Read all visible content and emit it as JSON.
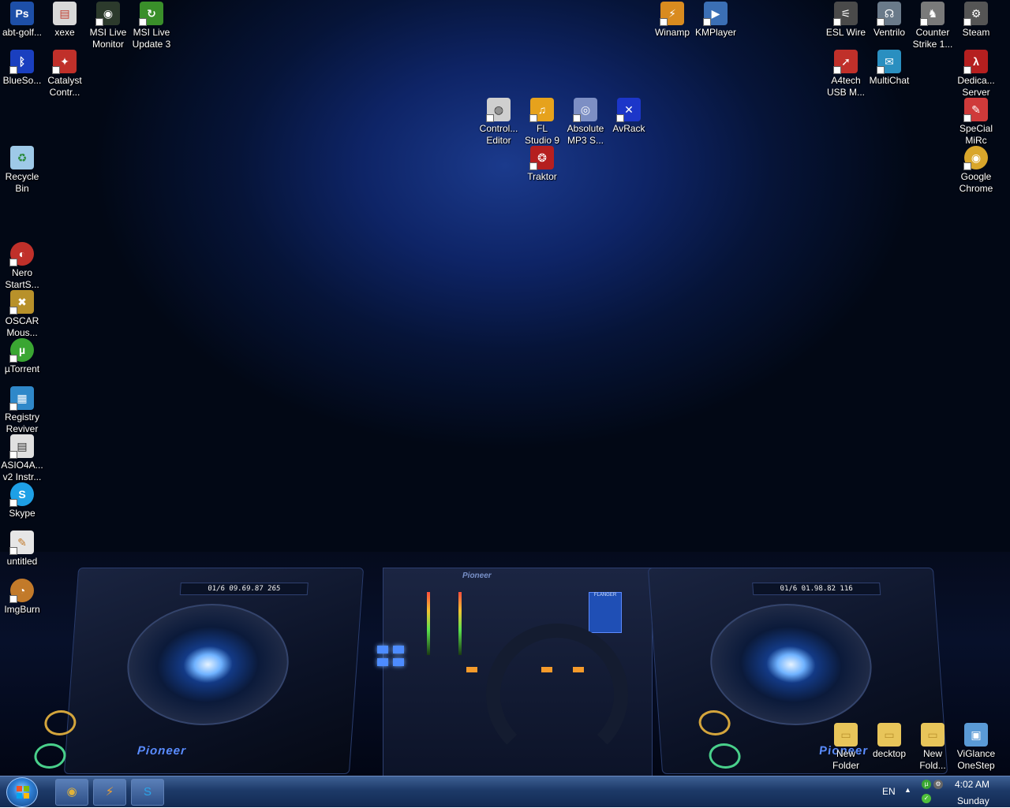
{
  "desktop": {
    "icons": [
      {
        "label": "abt-golf...",
        "icon": "photoshop-file-icon",
        "color": "#1d4fa8",
        "glyph": "Ps"
      },
      {
        "label": "xexe",
        "icon": "document-file-icon",
        "color": "#d9d9d9",
        "glyph": "▤"
      },
      {
        "label": "MSI Live\nMonitor",
        "icon": "msi-live-monitor-icon",
        "color": "#2c3a2c",
        "glyph": "◉"
      },
      {
        "label": "MSI Live\nUpdate 3",
        "icon": "msi-live-update-icon",
        "color": "#3a8f2a",
        "glyph": "↻"
      },
      {
        "label": "Winamp",
        "icon": "winamp-icon",
        "color": "#d98b1f",
        "glyph": "⚡"
      },
      {
        "label": "KMPlayer",
        "icon": "kmplayer-icon",
        "color": "#3b6fb5",
        "glyph": "▶"
      },
      {
        "label": "ESL Wire",
        "icon": "esl-wire-icon",
        "color": "#4a4a4a",
        "glyph": "⚟"
      },
      {
        "label": "Ventrilo",
        "icon": "ventrilo-icon",
        "color": "#6a7a8a",
        "glyph": "☊"
      },
      {
        "label": "Counter\nStrike 1...",
        "icon": "counter-strike-icon",
        "color": "#7a7a7a",
        "glyph": "♞"
      },
      {
        "label": "Steam",
        "icon": "steam-icon",
        "color": "#555555",
        "glyph": "⚙"
      },
      {
        "label": "BlueSo...",
        "icon": "bluetooth-icon",
        "color": "#1a3fbf",
        "glyph": "ᛒ"
      },
      {
        "label": "Catalyst\nContr...",
        "icon": "catalyst-control-icon",
        "color": "#c0302a",
        "glyph": "✦"
      },
      {
        "label": "A4tech\nUSB M...",
        "icon": "a4tech-mouse-icon",
        "color": "#c0302a",
        "glyph": "➚"
      },
      {
        "label": "MultiChat",
        "icon": "multichat-icon",
        "color": "#2a8fc0",
        "glyph": "✉"
      },
      {
        "label": "Dedica...\nServer",
        "icon": "dedicated-server-icon",
        "color": "#b51f1f",
        "glyph": "λ"
      },
      {
        "label": "Control...\nEditor",
        "icon": "control-editor-icon",
        "color": "#cfcfcf",
        "glyph": "◍"
      },
      {
        "label": "FL\nStudio 9",
        "icon": "fl-studio-icon",
        "color": "#e6a21c",
        "glyph": "♫"
      },
      {
        "label": "Absolute\nMP3 S...",
        "icon": "absolute-mp3-icon",
        "color": "#7d8fc4",
        "glyph": "◎"
      },
      {
        "label": "AvRack",
        "icon": "avrack-icon",
        "color": "#1c36c9",
        "glyph": "✕"
      },
      {
        "label": "SpeCial\nMiRc",
        "icon": "mirc-icon",
        "color": "#cf3a3a",
        "glyph": "✎"
      },
      {
        "label": "Traktor",
        "icon": "traktor-icon",
        "color": "#b51f1f",
        "glyph": "❂"
      },
      {
        "label": "Recycle\nBin",
        "icon": "recycle-bin-icon",
        "color": "#9ec9e8",
        "glyph": "♻"
      },
      {
        "label": "Google\nChrome",
        "icon": "chrome-icon",
        "color": "#d9a62b",
        "glyph": "◉"
      },
      {
        "label": "Nero\nStartS...",
        "icon": "nero-icon",
        "color": "#c0302a",
        "glyph": "◐"
      },
      {
        "label": "OSCAR\nMous...",
        "icon": "oscar-mouse-icon",
        "color": "#b8912a",
        "glyph": "✖"
      },
      {
        "label": "µTorrent",
        "icon": "utorrent-icon",
        "color": "#3aa632",
        "glyph": "µ"
      },
      {
        "label": "Registry\nReviver",
        "icon": "registry-reviver-icon",
        "color": "#2f88c9",
        "glyph": "▦"
      },
      {
        "label": "ASIO4A...\nv2 Instr...",
        "icon": "asio4all-icon",
        "color": "#e0e0e0",
        "glyph": "▤"
      },
      {
        "label": "Skype",
        "icon": "skype-icon",
        "color": "#1ea0e6",
        "glyph": "S"
      },
      {
        "label": "untitled",
        "icon": "untitled-file-icon",
        "color": "#e6e6e6",
        "glyph": "✎"
      },
      {
        "label": "ImgBurn",
        "icon": "imgburn-icon",
        "color": "#c27a2a",
        "glyph": "◔"
      },
      {
        "label": "New\nFolder",
        "icon": "folder-icon",
        "color": "#e8c55a",
        "glyph": "▭"
      },
      {
        "label": "decktop",
        "icon": "folder-icon",
        "color": "#e8c55a",
        "glyph": "▭"
      },
      {
        "label": "New\nFold...",
        "icon": "folder-icon",
        "color": "#e8c55a",
        "glyph": "▭"
      },
      {
        "label": "ViGlance\nOneStep",
        "icon": "viglance-icon",
        "color": "#5a9ad6",
        "glyph": "▣"
      }
    ]
  },
  "wallpaper": {
    "left_deck_display": "01/6   09.69.87   265",
    "right_deck_display": "01/6   01.98.82   116",
    "brand": "Pioneer",
    "mixer_brand": "Pioneer",
    "fx_label": "FLANGER"
  },
  "taskbar": {
    "buttons": [
      {
        "name": "taskbar-chrome-button",
        "glyph": "◉",
        "color": "#e0b23a"
      },
      {
        "name": "taskbar-winamp-button",
        "glyph": "⚡",
        "color": "#f0a030"
      },
      {
        "name": "taskbar-skype-button",
        "glyph": "S",
        "color": "#2aa4ea"
      }
    ],
    "language": "EN",
    "tray_arrow": "▲",
    "time": "4:02 AM",
    "day": "Sunday"
  }
}
